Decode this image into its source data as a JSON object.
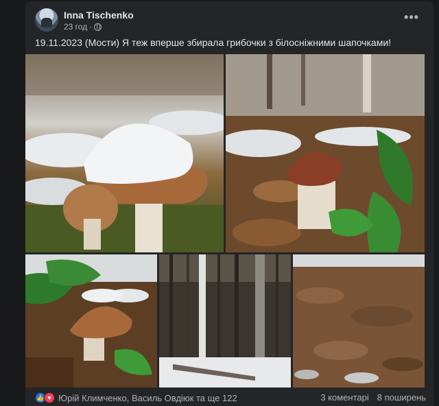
{
  "post": {
    "author": "Inna Tischenko",
    "time": "23 год",
    "separator": "·",
    "privacy_icon": "globe-icon",
    "more_label": "•••",
    "text": "19.11.2023 (Мости) Я теж вперше збирала грибочки з білосніжними шапочками!"
  },
  "photos": [
    {
      "description": "mushroom-with-snow-cap"
    },
    {
      "description": "mushroom-in-leaves"
    },
    {
      "description": "mushroom-with-snow"
    },
    {
      "description": "snowy-forest"
    },
    {
      "description": "forest-floor-leaves"
    }
  ],
  "footer": {
    "like_icon": "like-icon",
    "love_icon": "love-icon",
    "reactors": "Юрій Климченко, Василь Овдіюк та ще 122",
    "comments": "3 коментарі",
    "shares": "8 поширень"
  },
  "colors": {
    "background": "#18191a",
    "card": "#242526",
    "text": "#e4e6eb",
    "secondary": "#b0b3b8",
    "like": "#1877f2",
    "love": "#f33e58"
  }
}
